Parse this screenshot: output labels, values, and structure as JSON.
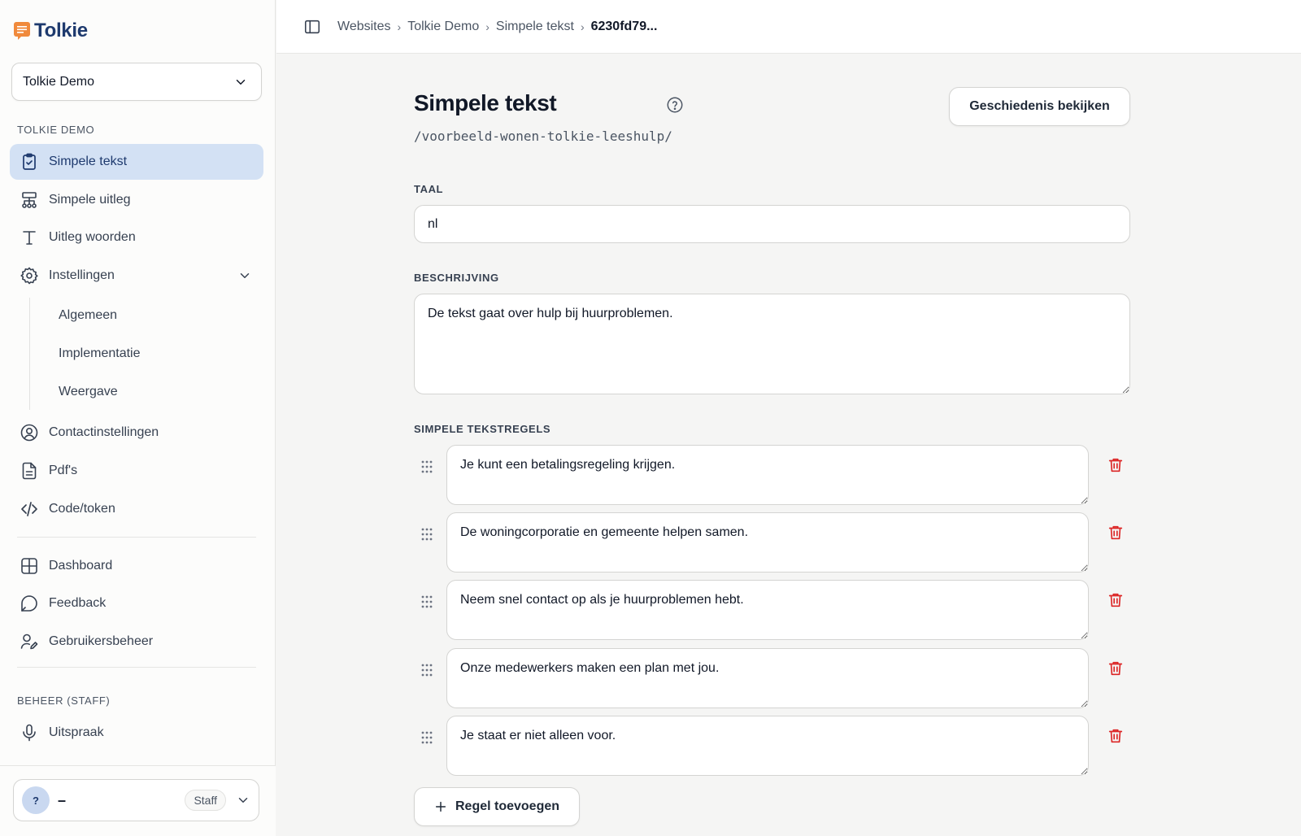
{
  "app": {
    "name": "Tolkie"
  },
  "site_selector": {
    "value": "Tolkie Demo"
  },
  "sidebar": {
    "section_title": "TOLKIE DEMO",
    "items": [
      {
        "label": "Simpele tekst",
        "icon": "clipboard-check-icon",
        "active": true
      },
      {
        "label": "Simpele uitleg",
        "icon": "sitemap-icon"
      },
      {
        "label": "Uitleg woorden",
        "icon": "text-type-icon"
      },
      {
        "label": "Instellingen",
        "icon": "gear-icon",
        "expanded": true
      }
    ],
    "sub_items": [
      {
        "label": "Algemeen"
      },
      {
        "label": "Implementatie"
      },
      {
        "label": "Weergave"
      }
    ],
    "items_after": [
      {
        "label": "Contactinstellingen",
        "icon": "user-circle-icon"
      },
      {
        "label": "Pdf's",
        "icon": "file-text-icon"
      },
      {
        "label": "Code/token",
        "icon": "code-icon"
      }
    ],
    "items_general": [
      {
        "label": "Dashboard",
        "icon": "grid-icon"
      },
      {
        "label": "Feedback",
        "icon": "chat-bubble-icon"
      },
      {
        "label": "Gebruikersbeheer",
        "icon": "user-edit-icon"
      }
    ],
    "staff_section_title": "BEHEER (STAFF)",
    "staff_items": [
      {
        "label": "Uitspraak",
        "icon": "microphone-icon"
      }
    ],
    "user": {
      "avatar": "?",
      "name": "–",
      "role": "Staff"
    }
  },
  "breadcrumb": [
    "Websites",
    "Tolkie Demo",
    "Simpele tekst",
    "6230fd79..."
  ],
  "page": {
    "title": "Simpele tekst",
    "path": "/voorbeeld-wonen-tolkie-leeshulp/",
    "history_button": "Geschiedenis bekijken"
  },
  "form": {
    "language": {
      "label": "TAAL",
      "value": "nl"
    },
    "description": {
      "label": "BESCHRIJVING",
      "value": "De tekst gaat over hulp bij huurproblemen."
    },
    "rules": {
      "label": "SIMPELE TEKSTREGELS",
      "items": [
        "Je kunt een betalingsregeling krijgen.",
        "De woningcorporatie en gemeente helpen samen.",
        "Neem snel contact op als je huurproblemen hebt.",
        "Onze medewerkers maken een plan met jou.",
        "Je staat er niet alleen voor."
      ],
      "add_button": "Regel toevoegen"
    }
  },
  "colors": {
    "brand": "#1e3a6e",
    "logo_accent": "#f08a3c",
    "active_nav_bg": "#d3e1f4",
    "danger": "#dc2626"
  }
}
